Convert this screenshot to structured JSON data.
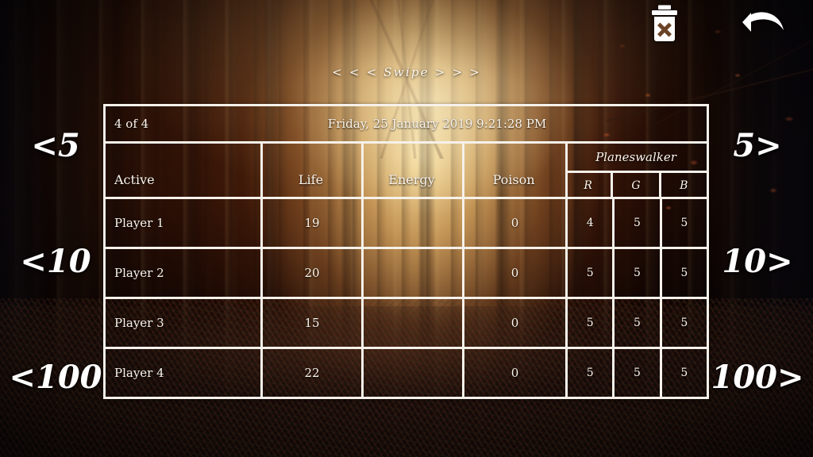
{
  "app": {
    "swipe_hint": "< < < Swipe > > >"
  },
  "toolbar": {
    "delete_icon": "trash-x-icon",
    "delete_label": "Delete",
    "undo_icon": "undo-arrow-icon",
    "undo_label": "Undo"
  },
  "side_controls": {
    "left": [
      {
        "label": "<5",
        "name": "decrement-5-button"
      },
      {
        "label": "<10",
        "name": "decrement-10-button"
      },
      {
        "label": "<100",
        "name": "decrement-100-button"
      }
    ],
    "right": [
      {
        "label": "5>",
        "name": "increment-5-button"
      },
      {
        "label": "10>",
        "name": "increment-10-button"
      },
      {
        "label": "100>",
        "name": "increment-100-button"
      }
    ]
  },
  "table": {
    "meta": {
      "count": "4 of 4",
      "timestamp": "Friday, 25 January 2019 9:21:28 PM"
    },
    "headers": {
      "active": "Active",
      "life": "Life",
      "energy": "Energy",
      "poison": "Poison",
      "planeswalker": "Planeswalker",
      "planeswalker_sub": [
        "R",
        "G",
        "B"
      ]
    },
    "rows": [
      {
        "name": "Player 1",
        "life": "19",
        "energy": "",
        "poison": "0",
        "r": "4",
        "g": "5",
        "b": "5"
      },
      {
        "name": "Player 2",
        "life": "20",
        "energy": "",
        "poison": "0",
        "r": "5",
        "g": "5",
        "b": "5"
      },
      {
        "name": "Player 3",
        "life": "15",
        "energy": "",
        "poison": "0",
        "r": "5",
        "g": "5",
        "b": "5"
      },
      {
        "name": "Player 4",
        "life": "22",
        "energy": "",
        "poison": "0",
        "r": "5",
        "g": "5",
        "b": "5"
      }
    ]
  },
  "colors": {
    "table_border": "#f6f1ea",
    "text": "#fbf5ec",
    "icon": "#ffffff"
  }
}
